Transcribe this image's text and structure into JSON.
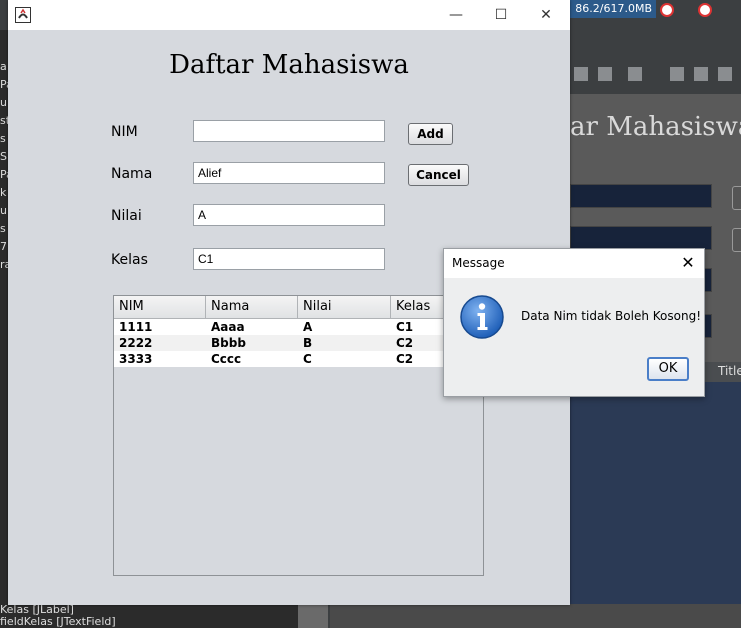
{
  "ide": {
    "memory": "86.2/617.0MB",
    "left_strip": [
      "a",
      "Pa",
      "ui",
      "st",
      "s",
      "S",
      "Pa",
      "k",
      "ui",
      "s",
      "7",
      "ra"
    ],
    "design_title": "ar Mahasiswa",
    "table_header": "Title",
    "bottom_lines": [
      "Kelas [JLabel]",
      "fieldKelas [JTextField]"
    ]
  },
  "frame": {
    "title": "",
    "heading": "Daftar Mahasiswa",
    "labels": {
      "nim": "NIM",
      "nama": "Nama",
      "nilai": "Nilai",
      "kelas": "Kelas"
    },
    "fields": {
      "nim": "",
      "nama": "Alief",
      "nilai": "A",
      "kelas": "C1"
    },
    "buttons": {
      "add": "Add",
      "cancel": "Cancel"
    },
    "window_controls": {
      "minimize": "—",
      "maximize": "☐",
      "close": "✕"
    },
    "table": {
      "columns": [
        "NIM",
        "Nama",
        "Nilai",
        "Kelas"
      ],
      "rows": [
        [
          "1111",
          "Aaaa",
          "A",
          "C1"
        ],
        [
          "2222",
          "Bbbb",
          "B",
          "C2"
        ],
        [
          "3333",
          "Cccc",
          "C",
          "C2"
        ]
      ]
    }
  },
  "dialog": {
    "title": "Message",
    "message": "Data Nim tidak Boleh Kosong!",
    "ok": "OK",
    "close": "✕",
    "icon": "info-icon"
  },
  "colors": {
    "frame_bg": "#d6d9de",
    "dialog_focus_border": "#4a7ec8",
    "info_icon_blue": "#1f5fb8"
  }
}
